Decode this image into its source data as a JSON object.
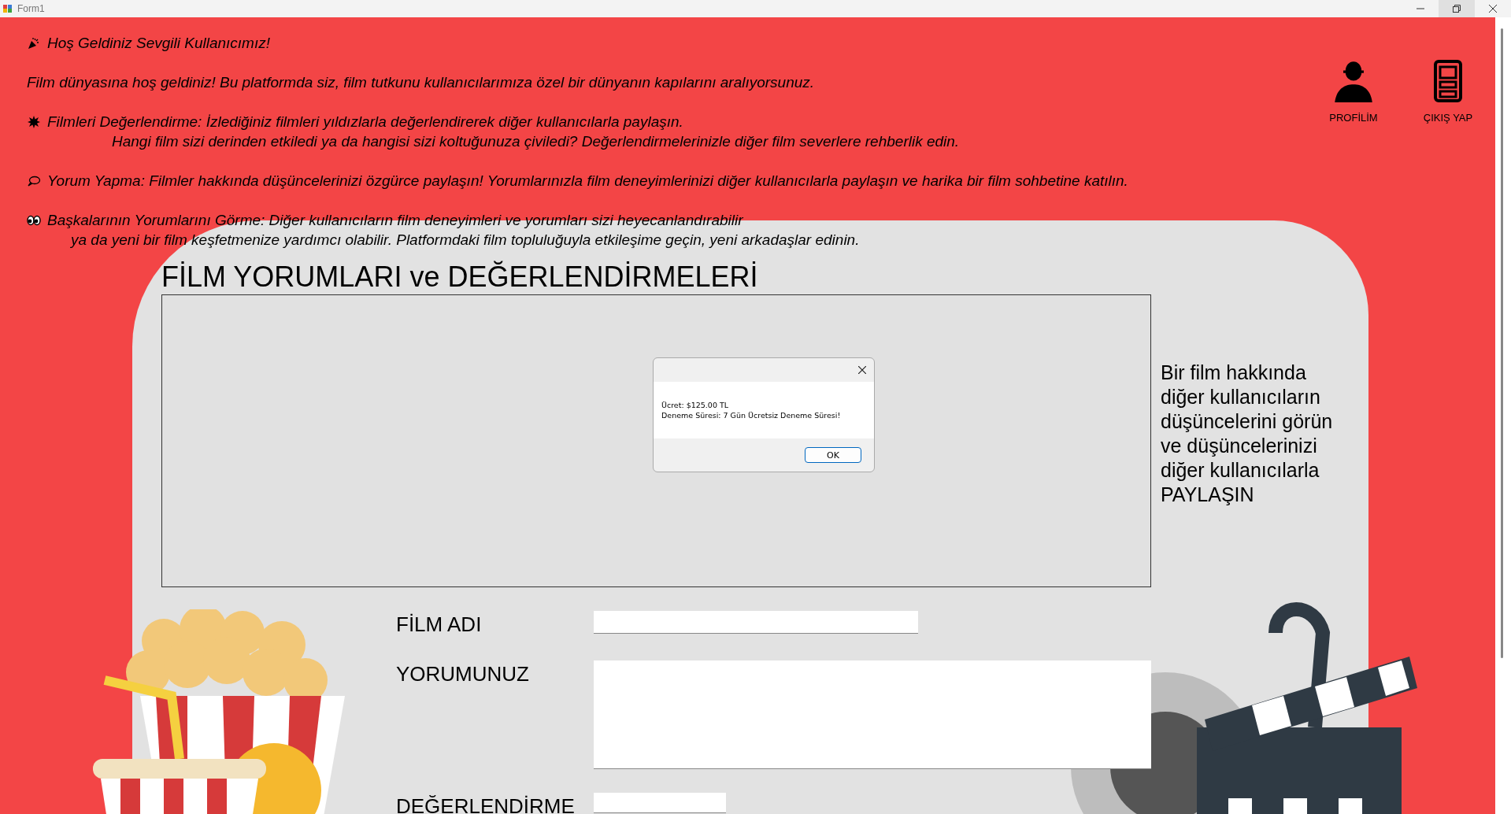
{
  "window": {
    "title": "Form1"
  },
  "intro": [
    {
      "kind": "greeting",
      "lines": [
        "Hoş Geldiniz Sevgili Kullanıcımız!"
      ]
    },
    {
      "kind": "plain",
      "lines": [
        "Film dünyasına hoş geldiniz! Bu platformda siz, film tutkunu kullanıcılarımıza özel bir dünyanın kapılarını aralıyorsunuz."
      ]
    },
    {
      "kind": "rating",
      "lines": [
        "Filmleri Değerlendirme: İzlediğiniz filmleri yıldızlarla değerlendirerek diğer kullanıcılarla paylaşın.",
        "Hangi film sizi derinden etkiledi ya da hangisi sizi koltuğunuza çiviledi? Değerlendirmelerinizle diğer film severlere rehberlik edin."
      ]
    },
    {
      "kind": "comment",
      "lines": [
        "Yorum Yapma: Filmler hakkında düşüncelerinizi özgürce paylaşın! Yorumlarınızla film deneyimlerinizi diğer kullanıcılarla paylaşın ve harika bir film sohbetine katılın."
      ]
    },
    {
      "kind": "others",
      "lines": [
        "Başkalarının Yorumlarını Görme: Diğer kullanıcıların film deneyimleri ve yorumları sizi heyecanlandırabilir",
        "ya da yeni bir film keşfetmenize yardımcı olabilir. Platformdaki film topluluğuyla etkileşime geçin, yeni arkadaşlar edinin."
      ]
    }
  ],
  "nav": [
    {
      "kind": "profile",
      "label": "PROFİLİM"
    },
    {
      "kind": "logout",
      "label": "ÇIKIŞ YAP"
    }
  ],
  "heading": "FİLM YORUMLARI ve DEĞERLENDİRMELERİ",
  "side_text": "Bir film hakkında diğer kullanıcıların düşüncelerini görün ve düşüncelerinizi diğer kullanıcılarla PAYLAŞIN",
  "dialog": {
    "lines": [
      "Ücret: $125.00 TL",
      "Deneme Süresi: 7 Gün Ücretsiz Deneme Süresi!"
    ],
    "button": "OK"
  },
  "form": [
    {
      "kind": "line",
      "label": "FİLM ADI"
    },
    {
      "kind": "multiline",
      "label": "YORUMUNUZ"
    },
    {
      "kind": "short",
      "label": "DEĞERLENDİRME"
    }
  ]
}
